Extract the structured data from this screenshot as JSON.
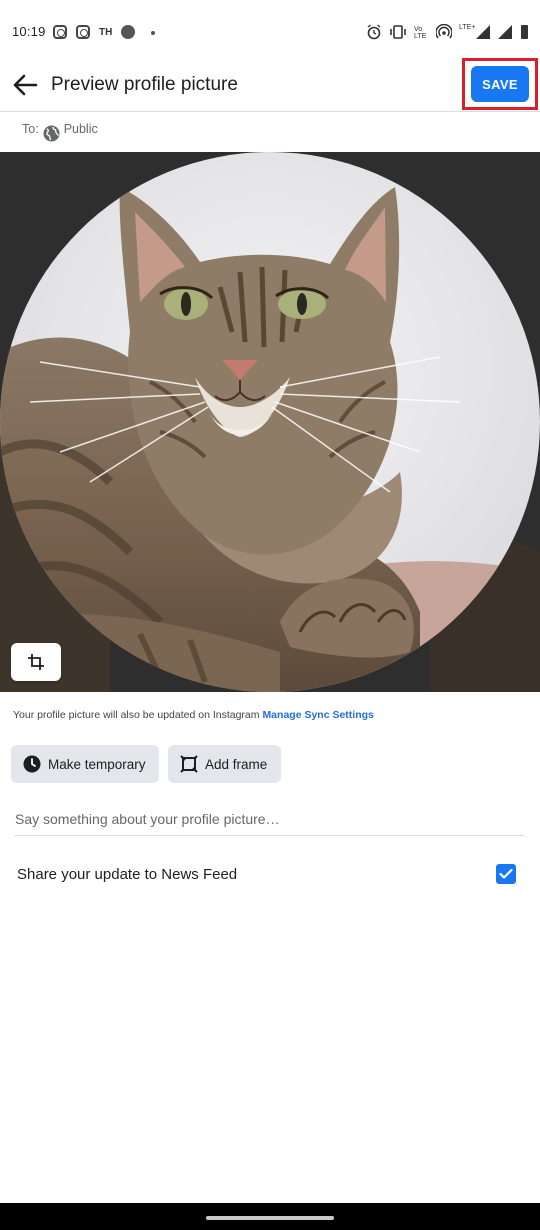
{
  "status_bar": {
    "time": "10:19",
    "carrier_label": "TH",
    "volte_label": "Vo\nLTE",
    "lte_label": "LTE+",
    "icons": [
      "instagram-icon",
      "instagram-icon",
      "circle-icon",
      "dot-icon",
      "alarm-icon",
      "vibrate-icon",
      "volte-icon",
      "hotspot-icon",
      "signal-icon",
      "signal-icon",
      "battery-icon"
    ]
  },
  "app_bar": {
    "title": "Preview profile picture",
    "save_label": "SAVE",
    "back_icon": "arrow-left-icon"
  },
  "audience": {
    "to_label": "To:",
    "value": "Public",
    "icon": "globe-icon"
  },
  "photo": {
    "description_icon": "cat-photo",
    "crop_icon": "crop-icon"
  },
  "sync": {
    "text": "Your profile picture will also be updated on Instagram",
    "link": "Manage Sync Settings"
  },
  "actions": {
    "make_temporary": "Make temporary",
    "add_frame": "Add frame"
  },
  "caption": {
    "placeholder": "Say something about your profile picture…",
    "value": ""
  },
  "share": {
    "label": "Share your update to News Feed",
    "checked": true
  },
  "colors": {
    "accent": "#1877f2",
    "highlight": "#d9202a",
    "link": "#216fdb"
  }
}
